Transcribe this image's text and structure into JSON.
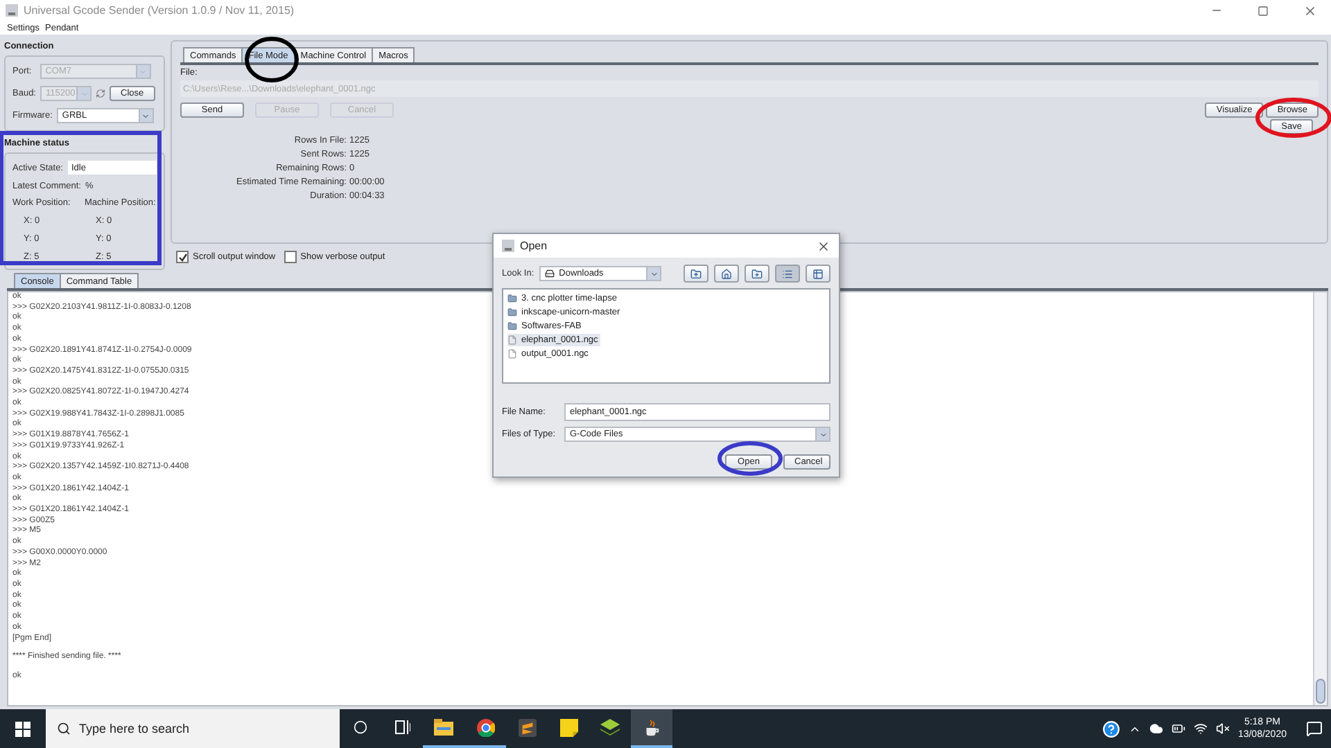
{
  "window": {
    "title": "Universal Gcode Sender (Version 1.0.9 / Nov 11, 2015)"
  },
  "menu": [
    "Settings",
    "Pendant"
  ],
  "connection": {
    "title": "Connection",
    "port": {
      "label": "Port:",
      "value": "COM7",
      "disabled": true
    },
    "baud": {
      "label": "Baud:",
      "value": "115200",
      "disabled": true
    },
    "close_button": "Close",
    "firmware": {
      "label": "Firmware:",
      "value": "GRBL",
      "disabled": false
    }
  },
  "machine_status": {
    "title": "Machine status",
    "active_state": {
      "label": "Active State:",
      "value": "Idle"
    },
    "latest_comment": {
      "label": "Latest Comment:",
      "value": "%"
    },
    "work_heading": "Work Position:",
    "machine_heading": "Machine Position:",
    "axes": [
      {
        "work_label": "X:",
        "work": "0",
        "machine_label": "X:",
        "machine": "0"
      },
      {
        "work_label": "Y:",
        "work": "0",
        "machine_label": "Y:",
        "machine": "0"
      },
      {
        "work_label": "Z:",
        "work": "5",
        "machine_label": "Z:",
        "machine": "5"
      }
    ]
  },
  "tabs": [
    {
      "label": "Commands",
      "selected": false
    },
    {
      "label": "File Mode",
      "selected": true
    },
    {
      "label": "Machine Control",
      "selected": false
    },
    {
      "label": "Macros",
      "selected": false
    }
  ],
  "file_mode": {
    "file_label": "File:",
    "path": "C:\\Users\\Rese...\\Downloads\\elephant_0001.ngc",
    "buttons": [
      {
        "label": "Send",
        "disabled": false
      },
      {
        "label": "Pause",
        "disabled": true
      },
      {
        "label": "Cancel",
        "disabled": true
      }
    ],
    "right_buttons": [
      "Visualize",
      "Browse"
    ],
    "save_button": "Save",
    "stats": [
      {
        "label": "Rows In File:",
        "value": "1225"
      },
      {
        "label": "Sent Rows:",
        "value": "1225"
      },
      {
        "label": "Remaining Rows:",
        "value": "0"
      },
      {
        "label": "Estimated Time Remaining:",
        "value": "00:00:00"
      },
      {
        "label": "Duration:",
        "value": "00:04:33"
      }
    ]
  },
  "options": [
    {
      "label": "Scroll output window",
      "checked": true
    },
    {
      "label": "Show verbose output",
      "checked": false
    }
  ],
  "console_tabs": [
    {
      "label": "Console",
      "selected": true
    },
    {
      "label": "Command Table",
      "selected": false
    }
  ],
  "console_lines": [
    {
      "text": "ok",
      "spaced": false
    },
    {
      "text": ">>> G02X20.2103Y41.9811Z-1I-0.8083J-0.1208",
      "spaced": false
    },
    {
      "text": "ok",
      "spaced": false
    },
    {
      "text": "ok",
      "spaced": false
    },
    {
      "text": "ok",
      "spaced": false
    },
    {
      "text": ">>> G02X20.1891Y41.8741Z-1I-0.2754J-0.0009",
      "spaced": false
    },
    {
      "text": "ok",
      "spaced": false
    },
    {
      "text": ">>> G02X20.1475Y41.8312Z-1I-0.0755J0.0315",
      "spaced": false
    },
    {
      "text": "ok",
      "spaced": false
    },
    {
      "text": ">>> G02X20.0825Y41.8072Z-1I-0.1947J0.4274",
      "spaced": false
    },
    {
      "text": "ok",
      "spaced": false
    },
    {
      "text": ">>> G02X19.988Y41.7843Z-1I-0.2898J1.0085",
      "spaced": false
    },
    {
      "text": "ok",
      "spaced": false
    },
    {
      "text": ">>> G01X19.8878Y41.7656Z-1",
      "spaced": false
    },
    {
      "text": ">>> G01X19.9733Y41.926Z-1",
      "spaced": false
    },
    {
      "text": "ok",
      "spaced": false
    },
    {
      "text": ">>> G02X20.1357Y42.1459Z-1I0.8271J-0.4408",
      "spaced": false
    },
    {
      "text": "ok",
      "spaced": false
    },
    {
      "text": ">>> G01X20.1861Y42.1404Z-1",
      "spaced": false
    },
    {
      "text": "ok",
      "spaced": false
    },
    {
      "text": ">>> G01X20.1861Y42.1404Z-1",
      "spaced": false
    },
    {
      "text": ">>> G00Z5",
      "spaced": false
    },
    {
      "text": ">>> M5",
      "spaced": false
    },
    {
      "text": "ok",
      "spaced": false
    },
    {
      "text": ">>> G00X0.0000Y0.0000",
      "spaced": false
    },
    {
      "text": ">>> M2",
      "spaced": false
    },
    {
      "text": "ok",
      "spaced": false
    },
    {
      "text": "ok",
      "spaced": false
    },
    {
      "text": "ok",
      "spaced": false
    },
    {
      "text": "ok",
      "spaced": false
    },
    {
      "text": "ok",
      "spaced": false
    },
    {
      "text": "ok",
      "spaced": false
    },
    {
      "text": "[Pgm End]",
      "spaced": false
    },
    {
      "text": "**** Finished sending file. ****",
      "spaced": true
    },
    {
      "text": "ok",
      "spaced": true
    }
  ],
  "dialog": {
    "title": "Open",
    "look_in": {
      "label": "Look In:",
      "value": "Downloads"
    },
    "files": [
      {
        "name": "3. cnc plotter time-lapse",
        "kind": "folder",
        "selected": false
      },
      {
        "name": "inkscape-unicorn-master",
        "kind": "folder",
        "selected": false
      },
      {
        "name": "Softwares-FAB",
        "kind": "folder",
        "selected": false
      },
      {
        "name": "elephant_0001.ngc",
        "kind": "file",
        "selected": true
      },
      {
        "name": "output_0001.ngc",
        "kind": "file",
        "selected": false
      }
    ],
    "file_name": {
      "label": "File Name:",
      "value": "elephant_0001.ngc"
    },
    "file_type": {
      "label": "Files of Type:",
      "value": "G-Code Files"
    },
    "buttons": [
      "Open",
      "Cancel"
    ]
  },
  "taskbar": {
    "search_placeholder": "Type here to search",
    "apps": [
      {
        "kind": "explorer",
        "running": true,
        "selected": false
      },
      {
        "kind": "chrome",
        "running": true,
        "selected": false
      },
      {
        "kind": "sublime",
        "running": false,
        "selected": false
      },
      {
        "kind": "sticky",
        "running": false,
        "selected": false
      },
      {
        "kind": "bluestacks",
        "running": false,
        "selected": false
      },
      {
        "kind": "java",
        "running": true,
        "selected": true
      }
    ],
    "time": "5:18 PM",
    "date": "13/08/2020"
  },
  "annotations": [
    {
      "kind": "ellipse",
      "color": "#000000"
    },
    {
      "kind": "ellipse",
      "color": "#e0141e"
    },
    {
      "kind": "rectangle",
      "color": "#3b3bc8"
    },
    {
      "kind": "ellipse",
      "color": "#3b3bc8"
    }
  ]
}
